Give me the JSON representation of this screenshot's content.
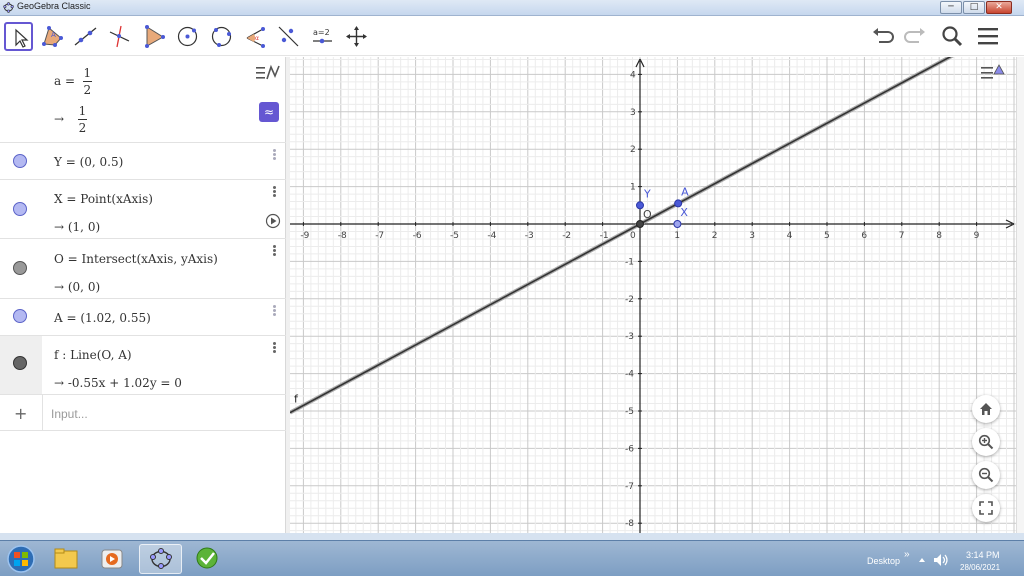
{
  "window": {
    "title": "GeoGebra Classic",
    "min_label": "─",
    "max_label": "□",
    "close_label": "✕"
  },
  "toolbar": {
    "tools": [
      "move-tool",
      "polygon-tool",
      "line-tool",
      "perpendicular-line-tool",
      "angle-bisector-tool",
      "circle-tool",
      "circle-three-points-tool",
      "angle-tool",
      "reflect-tool",
      "slider-tool",
      "move-graphics-tool"
    ],
    "slider_label": "a=2"
  },
  "algebra": {
    "rows": [
      {
        "expr_left": "a =",
        "frac_num": "1",
        "frac_den": "2",
        "out_arrow": "→",
        "out_num": "1",
        "out_den": "2"
      },
      {
        "expr": "Y = (0, 0.5)"
      },
      {
        "expr": "X = Point(xAxis)",
        "out": "→  (1, 0)"
      },
      {
        "expr": "O = Intersect(xAxis, yAxis)",
        "out": "→  (0, 0)"
      },
      {
        "expr": "A = (1.02, 0.55)"
      },
      {
        "expr": "f : Line(O, A)",
        "out": "→  -0.55x + 1.02y = 0"
      }
    ],
    "input_placeholder": "Input...",
    "input_plus": "+",
    "approx_label": "≈"
  },
  "graphics": {
    "x_ticks": [
      "-9",
      "-8",
      "-7",
      "-6",
      "-5",
      "-4",
      "-3",
      "-2",
      "-1",
      "0",
      "1",
      "2",
      "3",
      "4",
      "5",
      "6",
      "7",
      "8",
      "9"
    ],
    "y_ticks": [
      "4",
      "3",
      "2",
      "1",
      "-1",
      "-2",
      "-3",
      "-4",
      "-5",
      "-6",
      "-7",
      "-8"
    ],
    "points": [
      {
        "name": "Y",
        "x": 0,
        "y": 0.5
      },
      {
        "name": "X",
        "x": 1,
        "y": 0
      },
      {
        "name": "O",
        "x": 0,
        "y": 0
      },
      {
        "name": "A",
        "x": 1.02,
        "y": 0.55
      }
    ],
    "line_label": "f",
    "line_slope": 0.539,
    "point_color": "#4a59d6",
    "line_color": "#333333"
  },
  "taskbar": {
    "desktop_label": "Desktop",
    "chevron": "»",
    "time": "3:14 PM",
    "date": "28/06/2021"
  }
}
